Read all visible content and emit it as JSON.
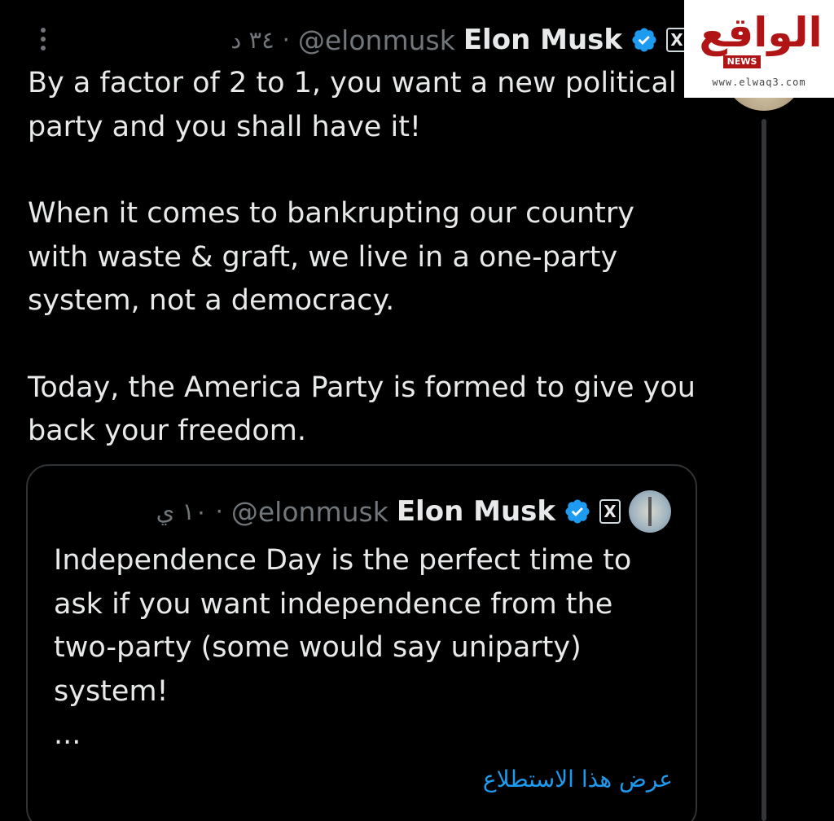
{
  "main_tweet": {
    "name": "Elon Musk",
    "handle": "@elonmusk",
    "separator": "·",
    "time": "٣٤ د",
    "x_badge": "X",
    "paragraphs": [
      "By a factor of 2 to 1, you want a new political party and you shall have it!",
      "When it comes to bankrupting our country with waste & graft, we live in a one-party system, not a democracy.",
      "Today, the America Party is formed to give you back your freedom."
    ]
  },
  "quoted_tweet": {
    "name": "Elon Musk",
    "handle": "@elonmusk",
    "separator": "·",
    "time": "١٠ ي",
    "x_badge": "X",
    "text_lines": [
      "Independence Day is the perfect time to",
      "ask if you want independence from the",
      "two-party (some would say uniparty)",
      "system!",
      "..."
    ],
    "show_poll_link": "عرض هذا الاستطلاع"
  },
  "watermark": {
    "logo_text": "الواقع",
    "badge": "NEWS",
    "url": "www.elwaq3.com"
  },
  "colors": {
    "background": "#000000",
    "text": "#e7e9ea",
    "muted": "#71767b",
    "link": "#1d9bf0",
    "verified": "#1d9bf0",
    "brand_red": "#b01414"
  },
  "icons": {
    "more": "more-vertical-icon",
    "verified": "verified-badge-icon",
    "x_logo": "x-logo-icon"
  }
}
